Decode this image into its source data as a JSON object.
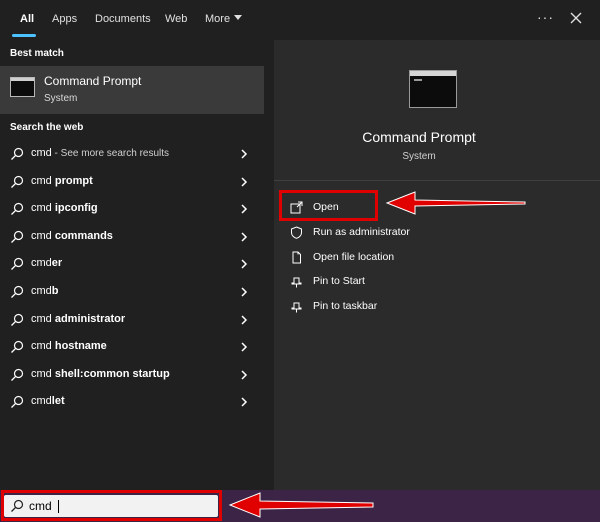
{
  "tabs": [
    {
      "label": "All",
      "active": true
    },
    {
      "label": "Apps"
    },
    {
      "label": "Documents"
    },
    {
      "label": "Web"
    },
    {
      "label": "More"
    }
  ],
  "window_controls": {
    "more_options": "···"
  },
  "left": {
    "best_match_label": "Best match",
    "best_match": {
      "title": "Command Prompt",
      "subtitle": "System",
      "icon": "command-prompt-icon"
    },
    "web_label": "Search the web",
    "web_results": [
      {
        "prefix": "cmd",
        "bold": "",
        "suffix": " - See more search results"
      },
      {
        "prefix": "cmd ",
        "bold": "prompt",
        "suffix": ""
      },
      {
        "prefix": "cmd ",
        "bold": "ipconfig",
        "suffix": ""
      },
      {
        "prefix": "cmd ",
        "bold": "commands",
        "suffix": ""
      },
      {
        "prefix": "cmd",
        "bold": "er",
        "suffix": ""
      },
      {
        "prefix": "cmd",
        "bold": "b",
        "suffix": ""
      },
      {
        "prefix": "cmd ",
        "bold": "administrator",
        "suffix": ""
      },
      {
        "prefix": "cmd ",
        "bold": "hostname",
        "suffix": ""
      },
      {
        "prefix": "cmd ",
        "bold": "shell:common startup",
        "suffix": ""
      },
      {
        "prefix": "cmd",
        "bold": "let",
        "suffix": ""
      }
    ]
  },
  "right": {
    "app_title": "Command Prompt",
    "app_subtitle": "System",
    "actions": [
      {
        "label": "Open",
        "icon": "open-icon"
      },
      {
        "label": "Run as administrator",
        "icon": "shield-icon"
      },
      {
        "label": "Open file location",
        "icon": "file-location-icon"
      },
      {
        "label": "Pin to Start",
        "icon": "pin-icon"
      },
      {
        "label": "Pin to taskbar",
        "icon": "pin-icon"
      }
    ]
  },
  "search": {
    "value": "cmd"
  },
  "colors": {
    "highlight": "#e10000",
    "accent": "#4cc2ff",
    "taskbar": "#3c2447"
  }
}
